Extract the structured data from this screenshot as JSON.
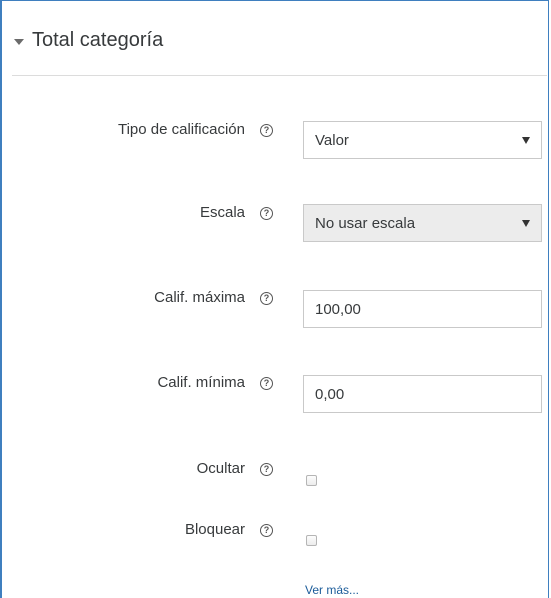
{
  "section": {
    "title": "Total categoría"
  },
  "fields": {
    "tipo": {
      "label": "Tipo de calificación",
      "value": "Valor"
    },
    "escala": {
      "label": "Escala",
      "value": "No usar escala"
    },
    "max": {
      "label": "Calif. máxima",
      "value": "100,00"
    },
    "min": {
      "label": "Calif. mínima",
      "value": "0,00"
    },
    "ocultar": {
      "label": "Ocultar",
      "checked": false
    },
    "bloquear": {
      "label": "Bloquear",
      "checked": false
    }
  },
  "help_glyph": "?",
  "more_link": "Ver más..."
}
